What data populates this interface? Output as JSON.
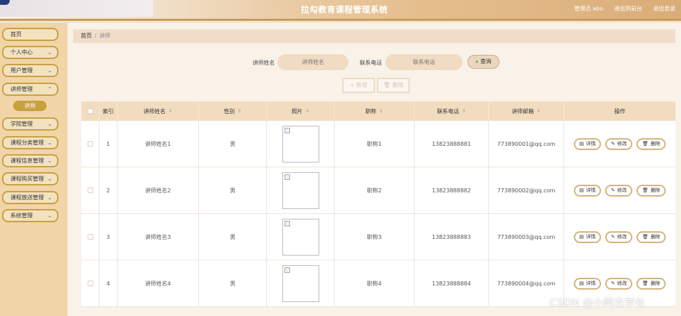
{
  "header": {
    "title": "拉勾教育课程管理系统",
    "user_label": "管理员 abo",
    "exit_front": "退出到前台",
    "logout": "退出登录"
  },
  "sidebar": {
    "items": [
      {
        "label": "首页",
        "chev": false
      },
      {
        "label": "个人中心",
        "chev": true
      },
      {
        "label": "用户管理",
        "chev": true
      },
      {
        "label": "讲师管理",
        "chev": true
      },
      {
        "label": "学院管理",
        "chev": true
      },
      {
        "label": "课程分类管理",
        "chev": true
      },
      {
        "label": "课程信息管理",
        "chev": true
      },
      {
        "label": "课程购买管理",
        "chev": true
      },
      {
        "label": "课程放送管理",
        "chev": true
      },
      {
        "label": "系统管理",
        "chev": true
      }
    ],
    "sub_active": "讲师"
  },
  "breadcrumb": {
    "home": "首页",
    "sep": "/",
    "current": "讲师"
  },
  "search": {
    "name_label": "讲师姓名",
    "name_placeholder": "讲师姓名",
    "phone_label": "联系电话",
    "phone_placeholder": "联系电话",
    "query_label": "查询",
    "query_icon": "search-icon"
  },
  "toolbar": {
    "add_label": "+ 新增",
    "delete_label": "删除"
  },
  "table": {
    "columns": [
      "索引",
      "讲师姓名",
      "性别",
      "照片",
      "职称",
      "联系电话",
      "讲师邮箱",
      "操作"
    ],
    "rows": [
      {
        "index": "1",
        "name": "讲师姓名1",
        "gender": "男",
        "title": "职称1",
        "phone": "13823888881",
        "email": "773890001@qq.com"
      },
      {
        "index": "2",
        "name": "讲师姓名2",
        "gender": "男",
        "title": "职称2",
        "phone": "13823888882",
        "email": "773890002@qq.com"
      },
      {
        "index": "3",
        "name": "讲师姓名3",
        "gender": "男",
        "title": "职称3",
        "phone": "13823888883",
        "email": "773890003@qq.com"
      },
      {
        "index": "4",
        "name": "讲师姓名4",
        "gender": "男",
        "title": "职称4",
        "phone": "13823888884",
        "email": "773890004@qq.com"
      }
    ],
    "actions": {
      "detail": "详情",
      "edit": "修改",
      "delete": "删除"
    }
  },
  "watermark": "CSDN @小阿杰学长",
  "colors": {
    "accent": "#c9a041",
    "header": "#e6bf8f",
    "table_head": "#f2dcc0"
  }
}
